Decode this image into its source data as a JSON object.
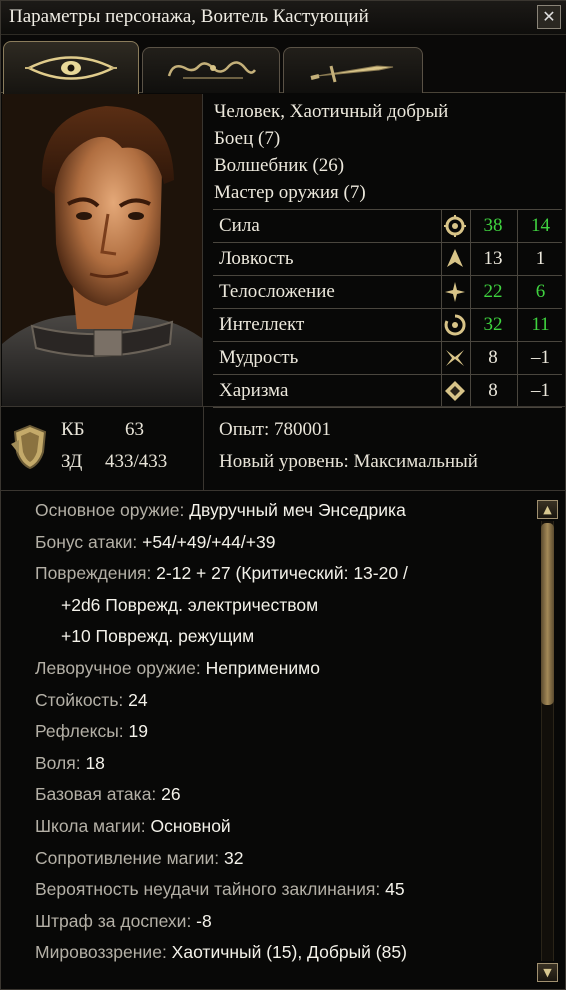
{
  "window": {
    "title": "Параметры персонажа, Воитель Кастующий",
    "close_symbol": "✕"
  },
  "tabs": [
    {
      "icon": "eye-icon",
      "active": true
    },
    {
      "icon": "scroll-ornament-icon",
      "active": false
    },
    {
      "icon": "sword-icon",
      "active": false
    }
  ],
  "character": {
    "race_alignment": "Человек, Хаотичный добрый",
    "classes": [
      "Боец (7)",
      "Волшебник (26)",
      "Мастер оружия (7)"
    ]
  },
  "stats": [
    {
      "name": "Сила",
      "icon": "strength-icon",
      "value": "38",
      "modifier": "14",
      "highlight": true
    },
    {
      "name": "Ловкость",
      "icon": "dexterity-icon",
      "value": "13",
      "modifier": "1",
      "highlight": false
    },
    {
      "name": "Телосложение",
      "icon": "constitution-icon",
      "value": "22",
      "modifier": "6",
      "highlight": true
    },
    {
      "name": "Интеллект",
      "icon": "intelligence-icon",
      "value": "32",
      "modifier": "11",
      "highlight": true
    },
    {
      "name": "Мудрость",
      "icon": "wisdom-icon",
      "value": "8",
      "modifier": "–1",
      "highlight": false
    },
    {
      "name": "Харизма",
      "icon": "charisma-icon",
      "value": "8",
      "modifier": "–1",
      "highlight": false
    }
  ],
  "defense": {
    "ac_label": "КБ",
    "ac_value": "63",
    "hp_label": "ЗД",
    "hp_value": "433/433"
  },
  "experience": {
    "xp": "Опыт: 780001",
    "next_level": "Новый уровень: Максимальный"
  },
  "details": [
    {
      "key": "Основное оружие: ",
      "value": "Двуручный меч Энседрика"
    },
    {
      "key": "Бонус атаки: ",
      "value": "+54/+49/+44/+39"
    },
    {
      "key": "Повреждения: ",
      "value": "2-12 + 27 (Критический:  13-20 /"
    },
    {
      "key": "",
      "value": "+2d6 Поврежд. электричеством",
      "indent": true
    },
    {
      "key": "",
      "value": "+10 Поврежд. режущим",
      "indent": true
    },
    {
      "key": "Леворучное оружие: ",
      "value": "Неприменимо"
    },
    {
      "key": "Стойкость: ",
      "value": "24"
    },
    {
      "key": "Рефлексы: ",
      "value": "19"
    },
    {
      "key": "Воля: ",
      "value": "18"
    },
    {
      "key": "Базовая атака: ",
      "value": "26"
    },
    {
      "key": "Школа магии: ",
      "value": "Основной"
    },
    {
      "key": "Сопротивление магии: ",
      "value": "32"
    },
    {
      "key": "Вероятность неудачи тайного заклинания: ",
      "value": "45"
    },
    {
      "key": "Штраф за доспехи: ",
      "value": "-8"
    },
    {
      "key": "Мировоззрение: ",
      "value": "Хаотичный (15), Добрый (85)"
    }
  ],
  "scrollbar": {
    "up_symbol": "▲",
    "down_symbol": "▼",
    "position": 0.0
  },
  "colors": {
    "bonus_green": "#3fd23f",
    "label_grey": "#b4b0a6",
    "value_white": "#f4f2ea"
  }
}
